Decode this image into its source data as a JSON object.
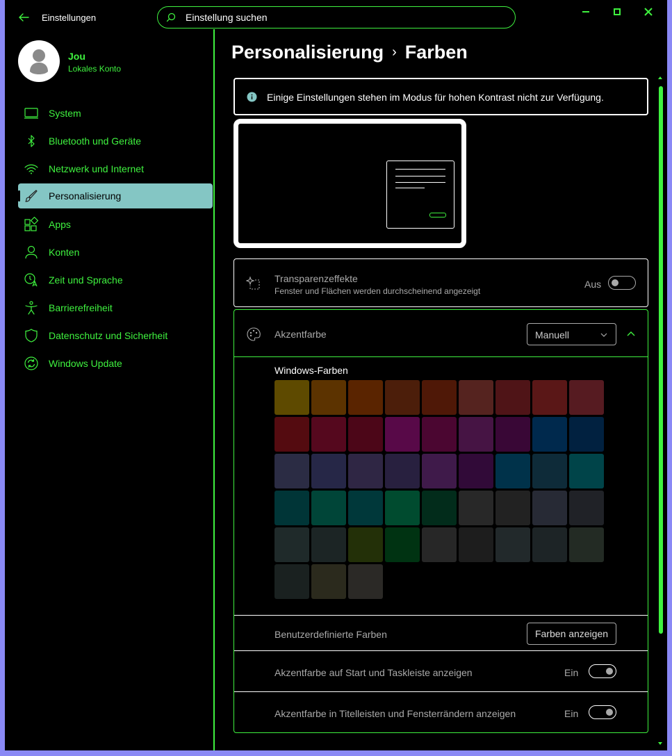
{
  "titlebar": {
    "app_title": "Einstellungen",
    "search_placeholder": "Einstellung suchen"
  },
  "user": {
    "name": "Jou",
    "account_type": "Lokales Konto"
  },
  "sidebar": {
    "items": [
      {
        "label": "System",
        "icon": "laptop-icon"
      },
      {
        "label": "Bluetooth und Geräte",
        "icon": "bluetooth-icon"
      },
      {
        "label": "Netzwerk und Internet",
        "icon": "wifi-icon"
      },
      {
        "label": "Personalisierung",
        "icon": "brush-icon",
        "active": true
      },
      {
        "label": "Apps",
        "icon": "apps-icon"
      },
      {
        "label": "Konten",
        "icon": "person-icon"
      },
      {
        "label": "Zeit und Sprache",
        "icon": "time-language-icon"
      },
      {
        "label": "Barrierefreiheit",
        "icon": "accessibility-icon"
      },
      {
        "label": "Datenschutz und Sicherheit",
        "icon": "shield-icon"
      },
      {
        "label": "Windows Update",
        "icon": "update-icon"
      }
    ]
  },
  "breadcrumb": {
    "parent": "Personalisierung",
    "separator": "›",
    "current": "Farben"
  },
  "info_bar": {
    "text": "Einige Einstellungen stehen im Modus für hohen Kontrast nicht zur Verfügung."
  },
  "transparency": {
    "title": "Transparenzeffekte",
    "description": "Fenster und Flächen werden durchscheinend angezeigt",
    "state": "Aus"
  },
  "accent": {
    "title": "Akzentfarbe",
    "dropdown_value": "Manuell",
    "swatches_title": "Windows-Farben",
    "swatch_colors": [
      "#5e4a00",
      "#5c3300",
      "#5a2400",
      "#4c1e0a",
      "#4f1807",
      "#55231f",
      "#4f1417",
      "#5a1717",
      "#561b21",
      "#540b10",
      "#55081e",
      "#4c0618",
      "#580948",
      "#4b0631",
      "#461444",
      "#390736",
      "#00294d",
      "#012140",
      "#2b2c44",
      "#262747",
      "#2f2644",
      "#28203f",
      "#3f1a4a",
      "#310a38",
      "#00324a",
      "#0e2b39",
      "#004449",
      "#003537",
      "#004538",
      "#00383a",
      "#004b2f",
      "#022c1b",
      "#282828",
      "#222222",
      "#272a35",
      "#202227",
      "#1f2a2a",
      "#1c2525",
      "#233008",
      "#003312",
      "#272727",
      "#1d1d1d",
      "#22292b",
      "#1d2426",
      "#232b24",
      "#1a2120",
      "#2b2a1d",
      "#2b2926"
    ],
    "custom_colors_label": "Benutzerdefinierte Farben",
    "custom_colors_button": "Farben anzeigen",
    "start_taskbar_label": "Akzentfarbe auf Start und Taskleiste anzeigen",
    "start_taskbar_state": "Ein",
    "titlebar_borders_label": "Akzentfarbe in Titelleisten und Fensterrändern anzeigen",
    "titlebar_borders_state": "Ein"
  }
}
